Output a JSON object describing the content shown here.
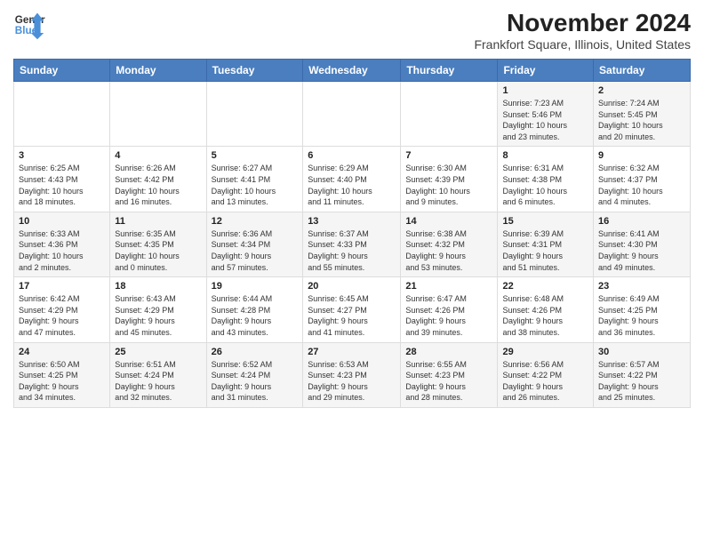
{
  "logo": {
    "line1": "General",
    "line2": "Blue"
  },
  "title": "November 2024",
  "subtitle": "Frankfort Square, Illinois, United States",
  "headers": [
    "Sunday",
    "Monday",
    "Tuesday",
    "Wednesday",
    "Thursday",
    "Friday",
    "Saturday"
  ],
  "weeks": [
    [
      {
        "day": "",
        "info": ""
      },
      {
        "day": "",
        "info": ""
      },
      {
        "day": "",
        "info": ""
      },
      {
        "day": "",
        "info": ""
      },
      {
        "day": "",
        "info": ""
      },
      {
        "day": "1",
        "info": "Sunrise: 7:23 AM\nSunset: 5:46 PM\nDaylight: 10 hours\nand 23 minutes."
      },
      {
        "day": "2",
        "info": "Sunrise: 7:24 AM\nSunset: 5:45 PM\nDaylight: 10 hours\nand 20 minutes."
      }
    ],
    [
      {
        "day": "3",
        "info": "Sunrise: 6:25 AM\nSunset: 4:43 PM\nDaylight: 10 hours\nand 18 minutes."
      },
      {
        "day": "4",
        "info": "Sunrise: 6:26 AM\nSunset: 4:42 PM\nDaylight: 10 hours\nand 16 minutes."
      },
      {
        "day": "5",
        "info": "Sunrise: 6:27 AM\nSunset: 4:41 PM\nDaylight: 10 hours\nand 13 minutes."
      },
      {
        "day": "6",
        "info": "Sunrise: 6:29 AM\nSunset: 4:40 PM\nDaylight: 10 hours\nand 11 minutes."
      },
      {
        "day": "7",
        "info": "Sunrise: 6:30 AM\nSunset: 4:39 PM\nDaylight: 10 hours\nand 9 minutes."
      },
      {
        "day": "8",
        "info": "Sunrise: 6:31 AM\nSunset: 4:38 PM\nDaylight: 10 hours\nand 6 minutes."
      },
      {
        "day": "9",
        "info": "Sunrise: 6:32 AM\nSunset: 4:37 PM\nDaylight: 10 hours\nand 4 minutes."
      }
    ],
    [
      {
        "day": "10",
        "info": "Sunrise: 6:33 AM\nSunset: 4:36 PM\nDaylight: 10 hours\nand 2 minutes."
      },
      {
        "day": "11",
        "info": "Sunrise: 6:35 AM\nSunset: 4:35 PM\nDaylight: 10 hours\nand 0 minutes."
      },
      {
        "day": "12",
        "info": "Sunrise: 6:36 AM\nSunset: 4:34 PM\nDaylight: 9 hours\nand 57 minutes."
      },
      {
        "day": "13",
        "info": "Sunrise: 6:37 AM\nSunset: 4:33 PM\nDaylight: 9 hours\nand 55 minutes."
      },
      {
        "day": "14",
        "info": "Sunrise: 6:38 AM\nSunset: 4:32 PM\nDaylight: 9 hours\nand 53 minutes."
      },
      {
        "day": "15",
        "info": "Sunrise: 6:39 AM\nSunset: 4:31 PM\nDaylight: 9 hours\nand 51 minutes."
      },
      {
        "day": "16",
        "info": "Sunrise: 6:41 AM\nSunset: 4:30 PM\nDaylight: 9 hours\nand 49 minutes."
      }
    ],
    [
      {
        "day": "17",
        "info": "Sunrise: 6:42 AM\nSunset: 4:29 PM\nDaylight: 9 hours\nand 47 minutes."
      },
      {
        "day": "18",
        "info": "Sunrise: 6:43 AM\nSunset: 4:29 PM\nDaylight: 9 hours\nand 45 minutes."
      },
      {
        "day": "19",
        "info": "Sunrise: 6:44 AM\nSunset: 4:28 PM\nDaylight: 9 hours\nand 43 minutes."
      },
      {
        "day": "20",
        "info": "Sunrise: 6:45 AM\nSunset: 4:27 PM\nDaylight: 9 hours\nand 41 minutes."
      },
      {
        "day": "21",
        "info": "Sunrise: 6:47 AM\nSunset: 4:26 PM\nDaylight: 9 hours\nand 39 minutes."
      },
      {
        "day": "22",
        "info": "Sunrise: 6:48 AM\nSunset: 4:26 PM\nDaylight: 9 hours\nand 38 minutes."
      },
      {
        "day": "23",
        "info": "Sunrise: 6:49 AM\nSunset: 4:25 PM\nDaylight: 9 hours\nand 36 minutes."
      }
    ],
    [
      {
        "day": "24",
        "info": "Sunrise: 6:50 AM\nSunset: 4:25 PM\nDaylight: 9 hours\nand 34 minutes."
      },
      {
        "day": "25",
        "info": "Sunrise: 6:51 AM\nSunset: 4:24 PM\nDaylight: 9 hours\nand 32 minutes."
      },
      {
        "day": "26",
        "info": "Sunrise: 6:52 AM\nSunset: 4:24 PM\nDaylight: 9 hours\nand 31 minutes."
      },
      {
        "day": "27",
        "info": "Sunrise: 6:53 AM\nSunset: 4:23 PM\nDaylight: 9 hours\nand 29 minutes."
      },
      {
        "day": "28",
        "info": "Sunrise: 6:55 AM\nSunset: 4:23 PM\nDaylight: 9 hours\nand 28 minutes."
      },
      {
        "day": "29",
        "info": "Sunrise: 6:56 AM\nSunset: 4:22 PM\nDaylight: 9 hours\nand 26 minutes."
      },
      {
        "day": "30",
        "info": "Sunrise: 6:57 AM\nSunset: 4:22 PM\nDaylight: 9 hours\nand 25 minutes."
      }
    ]
  ]
}
